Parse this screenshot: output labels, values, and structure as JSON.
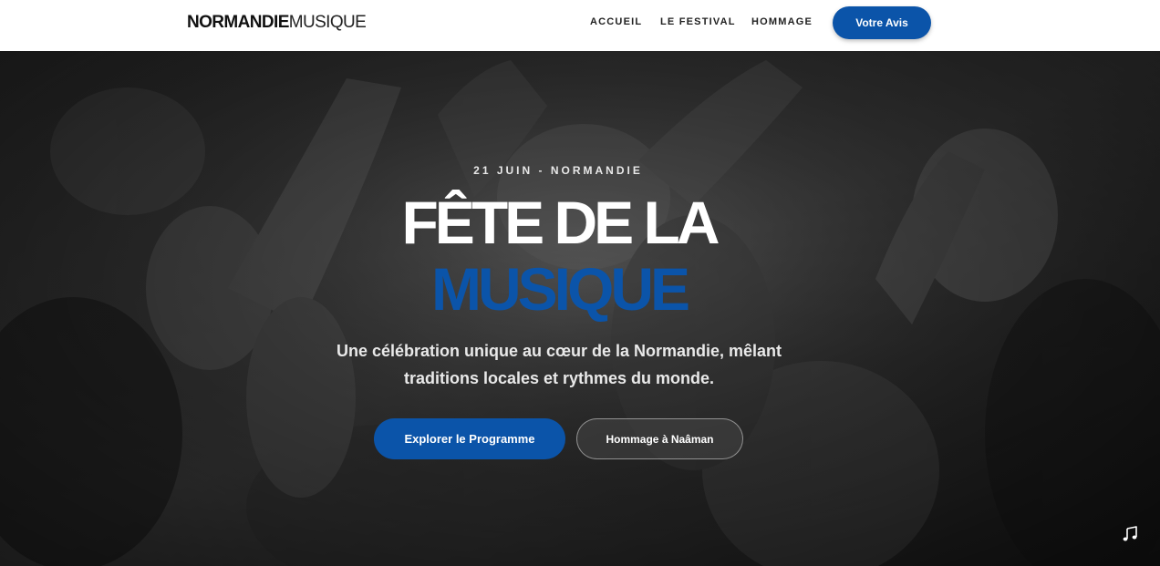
{
  "header": {
    "logo_bold": "NORMANDIE",
    "logo_light": "MUSIQUE",
    "nav": [
      {
        "label": "ACCUEIL"
      },
      {
        "label": "LE FESTIVAL"
      },
      {
        "label": "HOMMAGE"
      }
    ],
    "cta_label": "Votre Avis"
  },
  "hero": {
    "eyebrow": "21 JUIN - NORMANDIE",
    "title_line1": "FÊTE DE LA",
    "title_line2": "MUSIQUE",
    "subtitle": "Une célébration unique au cœur de la Normandie, mêlant traditions locales et rythmes du monde.",
    "primary_button": "Explorer le Programme",
    "secondary_button": "Hommage à Naâman",
    "background_image": "black-and-white crowd at a concert",
    "music_icon": "music-note-icon"
  },
  "colors": {
    "brand_blue": "#0b54a9",
    "header_bg": "#ffffff",
    "hero_text": "#ffffff"
  }
}
